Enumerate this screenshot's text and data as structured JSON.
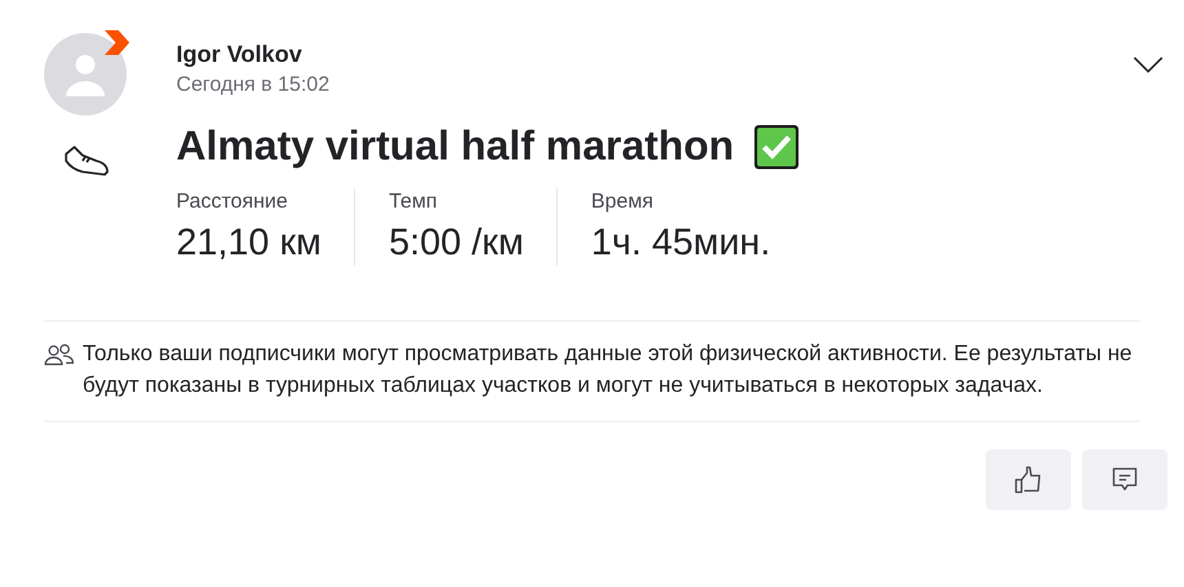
{
  "author": {
    "name": "Igor Volkov",
    "time": "Сегодня в 15:02"
  },
  "activity": {
    "title": "Almaty virtual half marathon"
  },
  "stats": [
    {
      "label": "Расстояние",
      "value": "21,10 км"
    },
    {
      "label": "Темп",
      "value": "5:00 /км"
    },
    {
      "label": "Время",
      "value": "1ч. 45мин."
    }
  ],
  "notice": "Только ваши подписчики могут просматривать данные этой физической активности. Ее результаты не будут показаны в турнирных таблицах участков и могут не учитываться в некоторых задачах."
}
